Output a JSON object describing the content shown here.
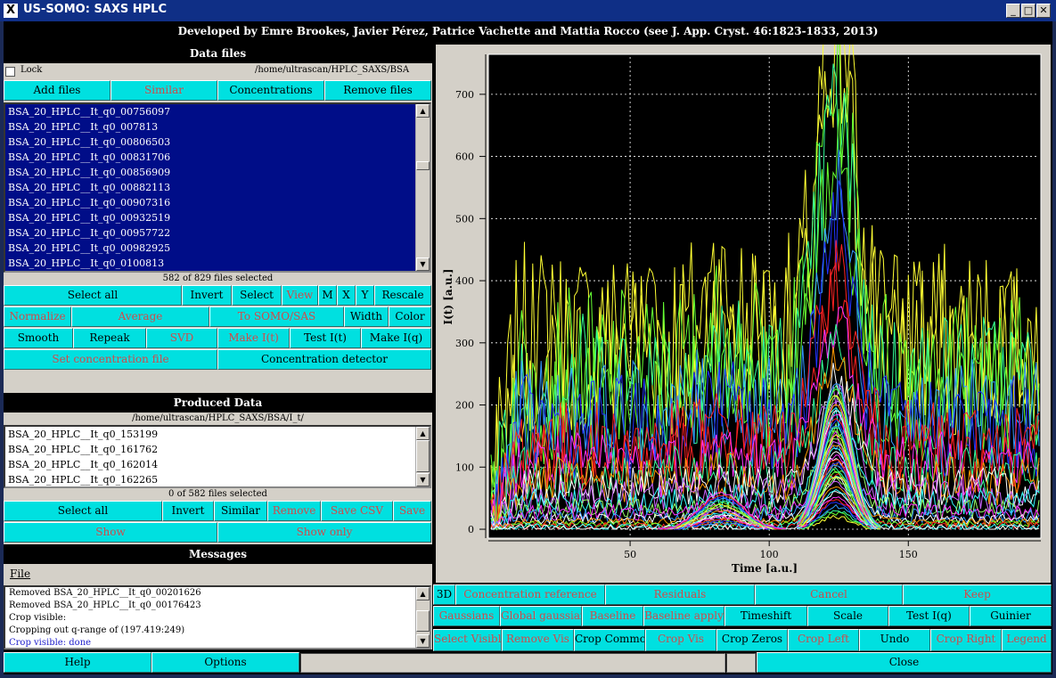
{
  "window": {
    "title": "US-SOMO: SAXS HPLC",
    "x_icon": "X",
    "minimize_icon": "_",
    "maximize_icon": "□",
    "close_icon": "✕"
  },
  "banner": "Developed by Emre Brookes, Javier Pérez, Patrice Vachette and Mattia Rocco (see J. App. Cryst. 46:1823-1833, 2013)",
  "data_files": {
    "header": "Data files",
    "lock_label": "Lock",
    "path": "/home/ultrascan/HPLC_SAXS/BSA",
    "buttons": [
      {
        "label": "Add files",
        "enabled": true
      },
      {
        "label": "Similar",
        "enabled": false
      },
      {
        "label": "Concentrations",
        "enabled": true
      },
      {
        "label": "Remove files",
        "enabled": true
      }
    ],
    "files": [
      "BSA_20_HPLC__It_q0_00756097",
      "BSA_20_HPLC__It_q0_007813",
      "BSA_20_HPLC__It_q0_00806503",
      "BSA_20_HPLC__It_q0_00831706",
      "BSA_20_HPLC__It_q0_00856909",
      "BSA_20_HPLC__It_q0_00882113",
      "BSA_20_HPLC__It_q0_00907316",
      "BSA_20_HPLC__It_q0_00932519",
      "BSA_20_HPLC__It_q0_00957722",
      "BSA_20_HPLC__It_q0_00982925",
      "BSA_20_HPLC__It_q0_0100813"
    ],
    "selection_status": "582 of 829 files selected",
    "row1": [
      {
        "label": "Select all",
        "enabled": true
      },
      {
        "label": "Invert",
        "enabled": true
      },
      {
        "label": "Select",
        "enabled": true
      },
      {
        "label": "View",
        "enabled": false
      },
      {
        "label": "M",
        "enabled": true
      },
      {
        "label": "X",
        "enabled": true
      },
      {
        "label": "Y",
        "enabled": true
      },
      {
        "label": "Rescale",
        "enabled": true
      }
    ],
    "row2": [
      {
        "label": "Normalize",
        "enabled": false
      },
      {
        "label": "Average",
        "enabled": false
      },
      {
        "label": "To SOMO/SAS",
        "enabled": false
      },
      {
        "label": "Width",
        "enabled": true
      },
      {
        "label": "Color",
        "enabled": true
      }
    ],
    "row3": [
      {
        "label": "Smooth",
        "enabled": true
      },
      {
        "label": "Repeak",
        "enabled": true
      },
      {
        "label": "SVD",
        "enabled": false
      },
      {
        "label": "Make I(t)",
        "enabled": false
      },
      {
        "label": "Test I(t)",
        "enabled": true
      },
      {
        "label": "Make I(q)",
        "enabled": true
      }
    ],
    "row4": [
      {
        "label": "Set concentration file",
        "enabled": false
      },
      {
        "label": "Concentration detector",
        "enabled": true
      }
    ]
  },
  "produced_data": {
    "header": "Produced Data",
    "path": "/home/ultrascan/HPLC_SAXS/BSA/I_t/",
    "files": [
      "BSA_20_HPLC__It_q0_153199",
      "BSA_20_HPLC__It_q0_161762",
      "BSA_20_HPLC__It_q0_162014",
      "BSA_20_HPLC__It_q0_162265"
    ],
    "selection_status": "0 of 582 files selected",
    "row1": [
      {
        "label": "Select all",
        "enabled": true
      },
      {
        "label": "Invert",
        "enabled": true
      },
      {
        "label": "Similar",
        "enabled": true
      },
      {
        "label": "Remove",
        "enabled": false
      },
      {
        "label": "Save CSV",
        "enabled": false
      },
      {
        "label": "Save",
        "enabled": false
      }
    ],
    "row2": [
      {
        "label": "Show",
        "enabled": false
      },
      {
        "label": "Show only",
        "enabled": false
      }
    ]
  },
  "messages": {
    "header": "Messages",
    "menu_file": "File",
    "lines": [
      {
        "text": "Removed BSA_20_HPLC__It_q0_00201626",
        "color": "#000000"
      },
      {
        "text": "Removed BSA_20_HPLC__It_q0_00176423",
        "color": "#000000"
      },
      {
        "text": "Crop visible:",
        "color": "#000000"
      },
      {
        "text": "Cropping out q-range of (197.419:249)",
        "color": "#000000"
      },
      {
        "text": "Crop visible: done",
        "color": "#2222cc"
      }
    ]
  },
  "bottom_bar": {
    "help": "Help",
    "options": "Options",
    "close": "Close"
  },
  "plot_buttons": {
    "row1": [
      {
        "label": "3D",
        "enabled": true
      },
      {
        "label": "Concentration reference",
        "enabled": false
      },
      {
        "label": "Residuals",
        "enabled": false
      },
      {
        "label": "Cancel",
        "enabled": false
      },
      {
        "label": "Keep",
        "enabled": false
      }
    ],
    "row2": [
      {
        "label": "Gaussians",
        "enabled": false
      },
      {
        "label": "Global gaussians",
        "enabled": false
      },
      {
        "label": "Baseline",
        "enabled": false
      },
      {
        "label": "Baseline apply",
        "enabled": false
      },
      {
        "label": "Timeshift",
        "enabled": true
      },
      {
        "label": "Scale",
        "enabled": true
      },
      {
        "label": "Test I(q)",
        "enabled": true
      },
      {
        "label": "Guinier",
        "enabled": true
      }
    ],
    "row3": [
      {
        "label": "Select Visible",
        "enabled": false
      },
      {
        "label": "Remove Vis",
        "enabled": false
      },
      {
        "label": "Crop Common",
        "enabled": true
      },
      {
        "label": "Crop Vis",
        "enabled": false
      },
      {
        "label": "Crop Zeros",
        "enabled": true
      },
      {
        "label": "Crop Left",
        "enabled": false
      },
      {
        "label": "Undo",
        "enabled": true
      },
      {
        "label": "Crop Right",
        "enabled": false
      },
      {
        "label": "Legend",
        "enabled": false
      }
    ]
  },
  "chart_data": {
    "type": "line",
    "xlabel": "Time [a.u.]",
    "ylabel": "I(t) [a.u.]",
    "xlim": [
      0,
      197
    ],
    "ylim": [
      -10,
      760
    ],
    "x_ticks": [
      50,
      100,
      150
    ],
    "y_ticks": [
      0,
      100,
      200,
      300,
      400,
      500,
      600,
      700
    ],
    "grid": true,
    "background": "#000000",
    "series_count": 582,
    "peaks": [
      {
        "center": 83,
        "height": 60
      },
      {
        "center": 124,
        "height": 250
      }
    ],
    "colors": [
      "#ffff33",
      "#66ff33",
      "#33ff99",
      "#3399ff",
      "#2233ff",
      "#ff2222",
      "#ff33ff",
      "#ffffff",
      "#33ffff",
      "#ff9900",
      "#cc66ff",
      "#99ff66"
    ]
  }
}
